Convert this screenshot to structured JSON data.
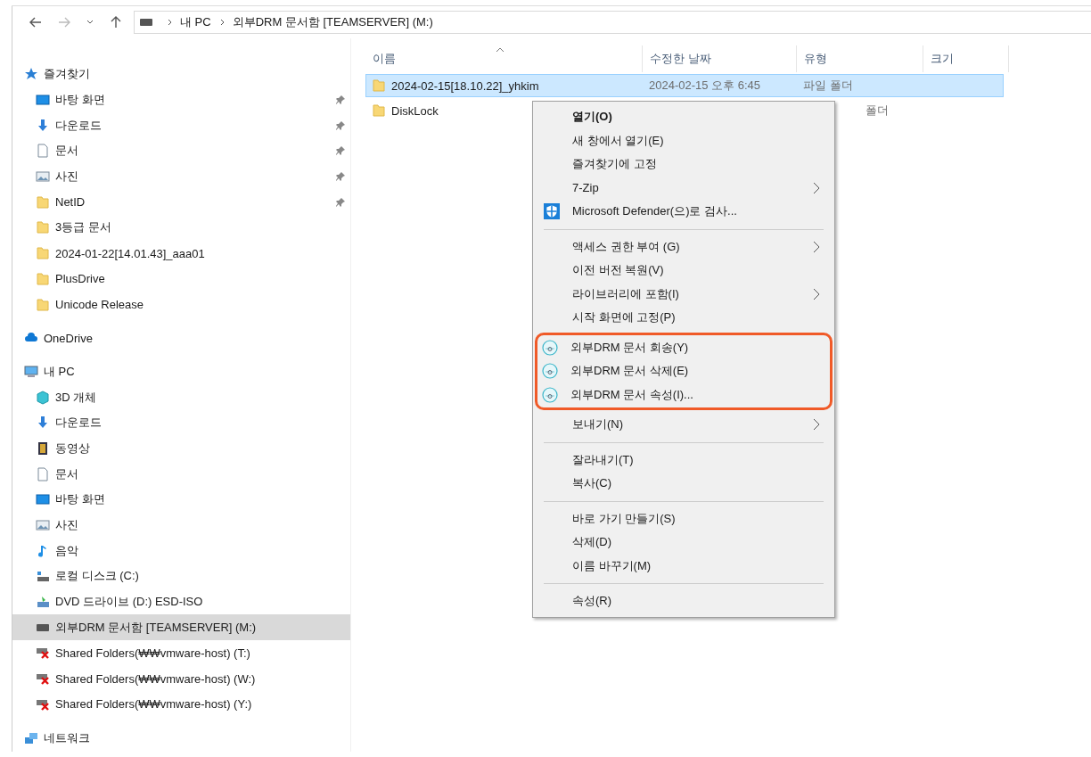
{
  "address_bar": {
    "segments": [
      "내 PC",
      "외부DRM 문서함 [TEAMSERVER] (M:)"
    ]
  },
  "sidebar": {
    "items": [
      {
        "label": "즐겨찾기",
        "kind": "star",
        "pinned": false,
        "selected": false,
        "children": [
          {
            "label": "바탕 화면",
            "kind": "desktop",
            "pinned": true,
            "selected": false
          },
          {
            "label": "다운로드",
            "kind": "download",
            "pinned": true,
            "selected": false
          },
          {
            "label": "문서",
            "kind": "document",
            "pinned": true,
            "selected": false
          },
          {
            "label": "사진",
            "kind": "picture",
            "pinned": true,
            "selected": false
          },
          {
            "label": "NetID",
            "kind": "folder",
            "pinned": true,
            "selected": false
          },
          {
            "label": "3등급 문서",
            "kind": "folder",
            "pinned": false,
            "selected": false
          },
          {
            "label": "2024-01-22[14.01.43]_aaa01",
            "kind": "folder",
            "pinned": false,
            "selected": false
          },
          {
            "label": "PlusDrive",
            "kind": "folder",
            "pinned": false,
            "selected": false
          },
          {
            "label": "Unicode Release",
            "kind": "folder",
            "pinned": false,
            "selected": false
          }
        ]
      },
      {
        "label": "OneDrive",
        "kind": "cloud",
        "pinned": false,
        "selected": false
      },
      {
        "label": "내 PC",
        "kind": "pc",
        "pinned": false,
        "selected": false,
        "children": [
          {
            "label": "3D 개체",
            "kind": "cube",
            "pinned": false,
            "selected": false
          },
          {
            "label": "다운로드",
            "kind": "download",
            "pinned": false,
            "selected": false
          },
          {
            "label": "동영상",
            "kind": "video",
            "pinned": false,
            "selected": false
          },
          {
            "label": "문서",
            "kind": "document",
            "pinned": false,
            "selected": false
          },
          {
            "label": "바탕 화면",
            "kind": "desktop",
            "pinned": false,
            "selected": false
          },
          {
            "label": "사진",
            "kind": "picture",
            "pinned": false,
            "selected": false
          },
          {
            "label": "음악",
            "kind": "music",
            "pinned": false,
            "selected": false
          },
          {
            "label": "로컬 디스크 (C:)",
            "kind": "disk",
            "pinned": false,
            "selected": false
          },
          {
            "label": "DVD 드라이브 (D:) ESD-ISO",
            "kind": "dvd",
            "pinned": false,
            "selected": false
          },
          {
            "label": "외부DRM 문서함 [TEAMSERVER] (M:)",
            "kind": "drive",
            "pinned": false,
            "selected": true
          },
          {
            "label": "Shared Folders(₩₩vmware-host) (T:)",
            "kind": "drive-x",
            "pinned": false,
            "selected": false
          },
          {
            "label": "Shared Folders(₩₩vmware-host) (W:)",
            "kind": "drive-x",
            "pinned": false,
            "selected": false
          },
          {
            "label": "Shared Folders(₩₩vmware-host) (Y:)",
            "kind": "drive-x",
            "pinned": false,
            "selected": false
          }
        ]
      },
      {
        "label": "네트워크",
        "kind": "network",
        "pinned": false,
        "selected": false
      }
    ]
  },
  "table": {
    "columns": [
      "이름",
      "수정한 날짜",
      "유형",
      "크기"
    ],
    "rows": [
      {
        "name": "2024-02-15[18.10.22]_yhkim",
        "date": "2024-02-15 오후 6:45",
        "type": "파일 폴더",
        "selected": true
      },
      {
        "name": "DiskLock",
        "type": "폴더",
        "selected": false
      }
    ]
  },
  "context_menu": {
    "groups": [
      {
        "highlighted": false,
        "separator_before": false,
        "items": [
          {
            "label": "열기(O)",
            "default": true,
            "submenu": false
          },
          {
            "label": "새 창에서 열기(E)",
            "default": false,
            "submenu": false
          },
          {
            "label": "즐겨찾기에 고정",
            "default": false,
            "submenu": false
          },
          {
            "label": "7-Zip",
            "default": false,
            "submenu": true
          },
          {
            "label": "Microsoft Defender(으)로 검사...",
            "kind": "shield",
            "default": false,
            "submenu": false
          }
        ]
      },
      {
        "highlighted": false,
        "separator_before": true,
        "items": [
          {
            "label": "액세스 권한 부여 (G)",
            "default": false,
            "submenu": true
          },
          {
            "label": "이전 버전 복원(V)",
            "default": false,
            "submenu": false
          },
          {
            "label": "라이브러리에 포함(I)",
            "default": false,
            "submenu": true
          },
          {
            "label": "시작 화면에 고정(P)",
            "default": false,
            "submenu": false
          }
        ]
      },
      {
        "highlighted": true,
        "separator_before": false,
        "items": [
          {
            "label": "외부DRM 문서 회송(Y)",
            "kind": "doc",
            "default": false,
            "submenu": false
          },
          {
            "label": "외부DRM 문서 삭제(E)",
            "kind": "doc",
            "default": false,
            "submenu": false
          },
          {
            "label": "외부DRM 문서 속성(I)...",
            "kind": "doc",
            "default": false,
            "submenu": false
          }
        ]
      },
      {
        "highlighted": false,
        "separator_before": false,
        "items": [
          {
            "label": "보내기(N)",
            "default": false,
            "submenu": true
          }
        ]
      },
      {
        "highlighted": false,
        "separator_before": true,
        "items": [
          {
            "label": "잘라내기(T)",
            "default": false,
            "submenu": false
          },
          {
            "label": "복사(C)",
            "default": false,
            "submenu": false
          }
        ]
      },
      {
        "highlighted": false,
        "separator_before": true,
        "items": [
          {
            "label": "바로 가기 만들기(S)",
            "default": false,
            "submenu": false
          },
          {
            "label": "삭제(D)",
            "default": false,
            "submenu": false
          },
          {
            "label": "이름 바꾸기(M)",
            "default": false,
            "submenu": false
          }
        ]
      },
      {
        "highlighted": false,
        "separator_before": true,
        "items": [
          {
            "label": "속성(R)",
            "default": false,
            "submenu": false
          }
        ]
      }
    ]
  }
}
